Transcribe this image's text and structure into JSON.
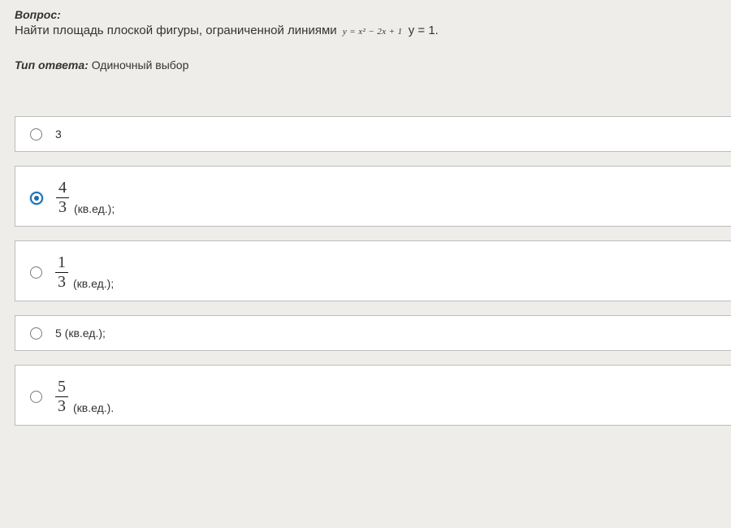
{
  "question": {
    "label": "Вопрос:",
    "text_before": "Найти площадь плоской фигуры, ограниченной линиями",
    "formula": "y = x² − 2x + 1",
    "text_after": "y  =  1."
  },
  "answer_type": {
    "label": "Тип ответа:",
    "value": "Одиночный выбор"
  },
  "options": [
    {
      "kind": "plain",
      "text": "3",
      "selected": false
    },
    {
      "kind": "frac",
      "num": "4",
      "den": "3",
      "unit": "(кв.ед.);",
      "selected": true
    },
    {
      "kind": "frac",
      "num": "1",
      "den": "3",
      "unit": "(кв.ед.);",
      "selected": false
    },
    {
      "kind": "plain",
      "text": "5 (кв.ед.);",
      "selected": false
    },
    {
      "kind": "frac",
      "num": "5",
      "den": "3",
      "unit": "(кв.ед.).",
      "selected": false
    }
  ]
}
